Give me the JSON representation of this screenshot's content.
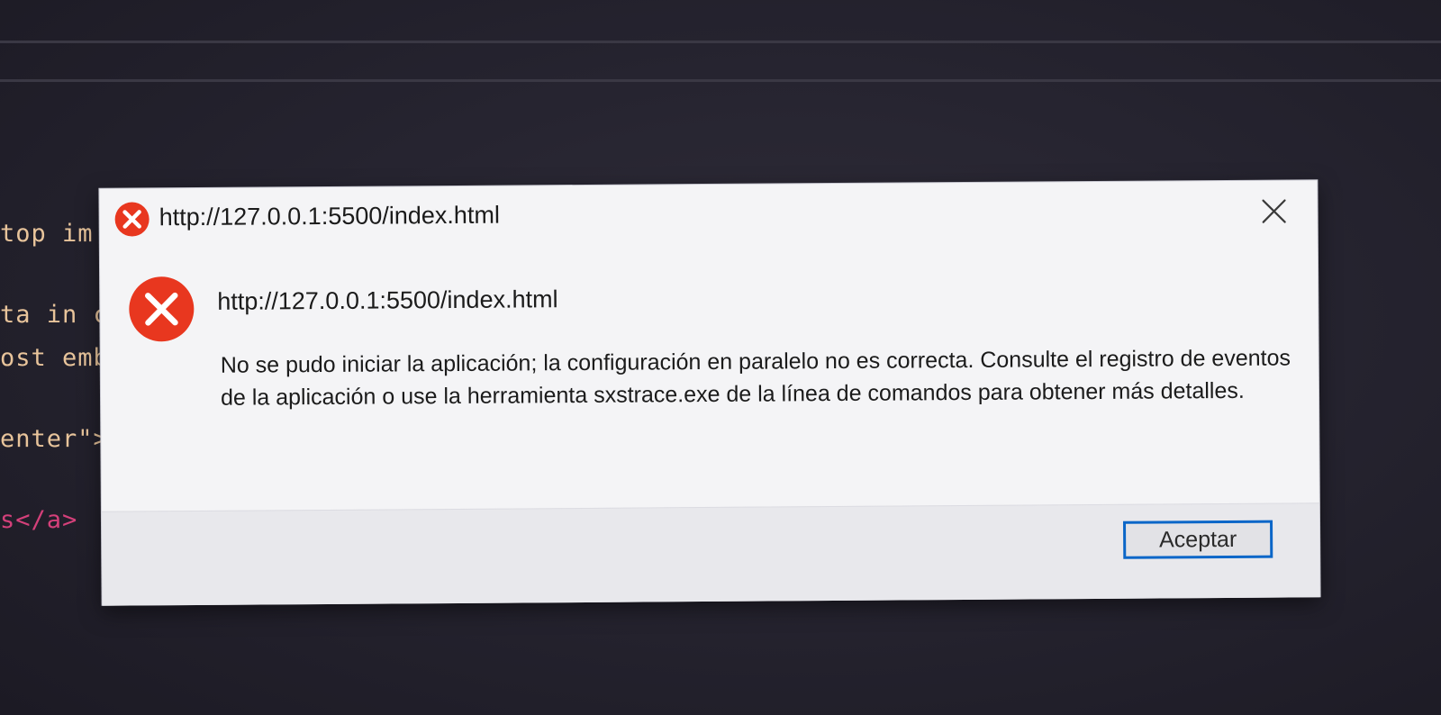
{
  "background_editor": {
    "lines": [
      "top im",
      "ta in c",
      "ost emb",
      "enter\">",
      "s</a>"
    ]
  },
  "dialog": {
    "title": "http://127.0.0.1:5500/index.html",
    "heading": "http://127.0.0.1:5500/index.html",
    "message": "No se pudo iniciar la aplicación; la configuración en paralelo no es correcta. Consulte el registro de eventos de la aplicación o use la herramienta sxstrace.exe de la línea de comandos para obtener más detalles.",
    "ok_label": "Aceptar",
    "icons": {
      "title_icon": "error-icon",
      "content_icon": "error-icon",
      "close_icon": "close-icon"
    },
    "colors": {
      "error_red": "#e8371f",
      "button_border": "#0a66c8"
    }
  }
}
